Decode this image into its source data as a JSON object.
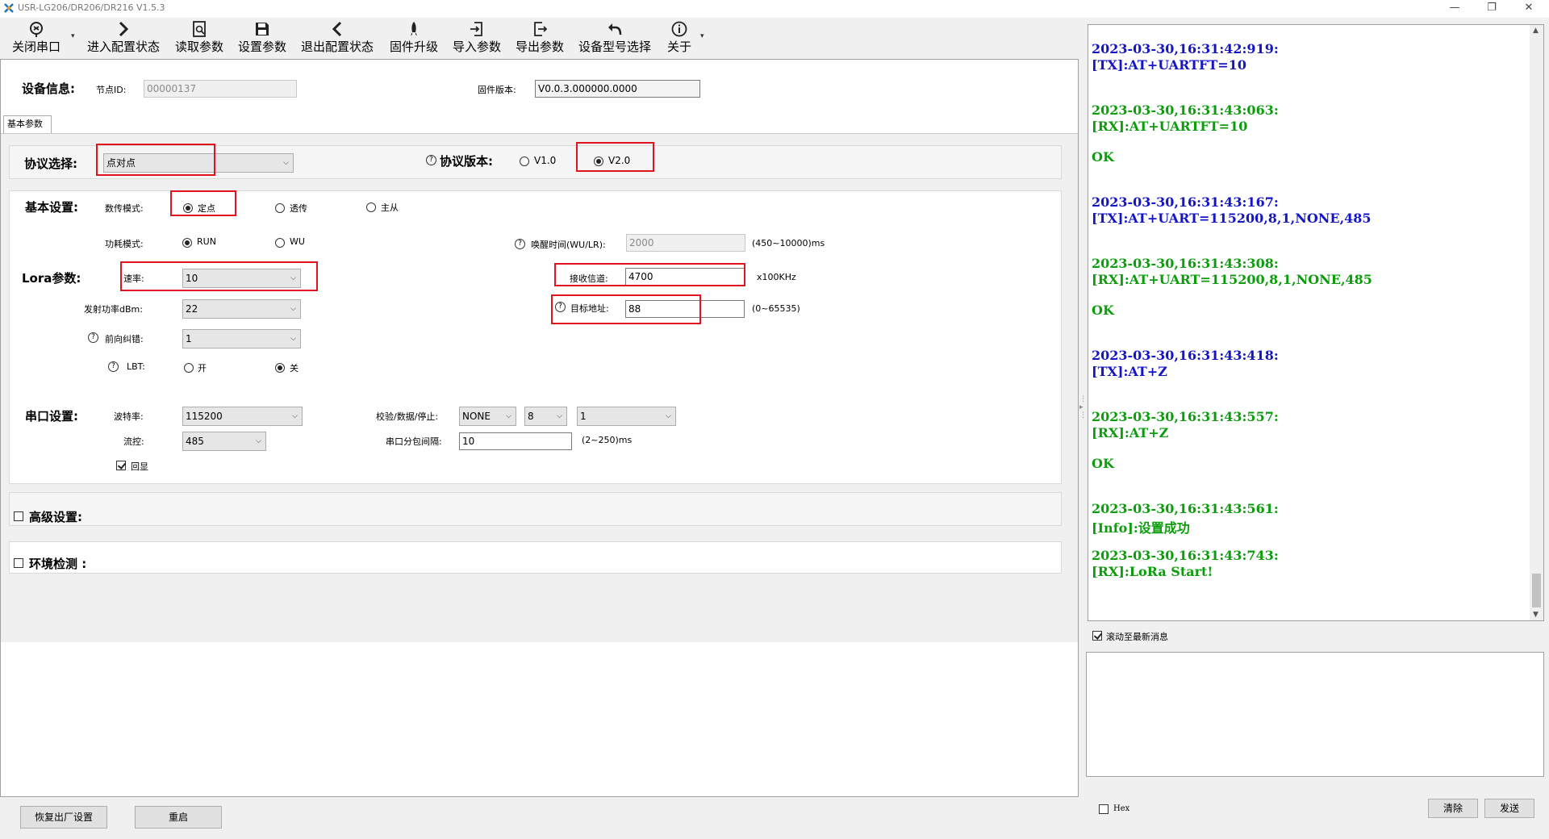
{
  "window": {
    "title": "USR-LG206/DR206/DR216 V1.5.3",
    "minimize": "—",
    "restore": "❐",
    "close": "✕"
  },
  "toolbar": {
    "close_port": "关闭串口",
    "enter_config": "进入配置状态",
    "read_params": "读取参数",
    "set_params": "设置参数",
    "exit_config": "退出配置状态",
    "firmware_upgrade": "固件升级",
    "import_params": "导入参数",
    "export_params": "导出参数",
    "device_model": "设备型号选择",
    "about": "关于"
  },
  "device_info": {
    "title": "设备信息:",
    "node_id_label": "节点ID:",
    "node_id_value": "00000137",
    "firmware_label": "固件版本:",
    "firmware_value": "V0.0.3.000000.0000"
  },
  "tab": {
    "label": "基本参数"
  },
  "protocol": {
    "title": "协议选择:",
    "selected": "点对点",
    "version_title": "协议版本:",
    "v1": "V1.0",
    "v2": "V2.0",
    "selected_version": "V2.0"
  },
  "basic": {
    "title": "基本设置:",
    "mode_label": "数传模式:",
    "mode_options": [
      "定点",
      "透传",
      "主从"
    ],
    "mode_selected": "定点",
    "power_label": "功耗模式:",
    "power_options": [
      "RUN",
      "WU"
    ],
    "power_selected": "RUN",
    "wake_label": "唤醒时间(WU/LR):",
    "wake_value": "2000",
    "wake_range": "(450~10000)ms"
  },
  "lora": {
    "title": "Lora参数:",
    "rate_label": "速率:",
    "rate_value": "10",
    "channel_label": "接收信道:",
    "channel_value": "4700",
    "channel_unit": "x100KHz",
    "tx_power_label": "发射功率dBm:",
    "tx_power_value": "22",
    "target_label": "目标地址:",
    "target_value": "88",
    "target_range": "(0~65535)",
    "fec_label": "前向纠错:",
    "fec_value": "1",
    "lbt_label": "LBT:",
    "lbt_on": "开",
    "lbt_off": "关",
    "lbt_selected": "关"
  },
  "serial": {
    "title": "串口设置:",
    "baud_label": "波特率:",
    "baud_value": "115200",
    "parity_label": "校验/数据/停止:",
    "parity_value": "NONE",
    "data_bits": "8",
    "stop_bits": "1",
    "flow_label": "流控:",
    "flow_value": "485",
    "interval_label": "串口分包间隔:",
    "interval_value": "10",
    "interval_range": "(2~250)ms",
    "echo_label": "回显",
    "echo_checked": true
  },
  "advanced": {
    "title": "高级设置:"
  },
  "env": {
    "title": "环境检测 :"
  },
  "bottom": {
    "factory_reset": "恢复出厂设置",
    "restart": "重启"
  },
  "log": {
    "lines": [
      {
        "text": "2023-03-30,16:31:42:919:",
        "color": "#1515c8"
      },
      {
        "text": "[TX]:AT+UARTFT=10",
        "color": "#1515c8"
      },
      {
        "text": "2023-03-30,16:31:43:063:",
        "color": "#0b9d0b"
      },
      {
        "text": "[RX]:AT+UARTFT=10",
        "color": "#0b9d0b"
      },
      {
        "text": "OK",
        "color": "#0b9d0b"
      },
      {
        "text": "2023-03-30,16:31:43:167:",
        "color": "#1515c8"
      },
      {
        "text": "[TX]:AT+UART=115200,8,1,NONE,485",
        "color": "#1515c8"
      },
      {
        "text": "2023-03-30,16:31:43:308:",
        "color": "#0b9d0b"
      },
      {
        "text": "[RX]:AT+UART=115200,8,1,NONE,485",
        "color": "#0b9d0b"
      },
      {
        "text": "OK",
        "color": "#0b9d0b"
      },
      {
        "text": "2023-03-30,16:31:43:418:",
        "color": "#1515c8"
      },
      {
        "text": "[TX]:AT+Z",
        "color": "#1515c8"
      },
      {
        "text": "2023-03-30,16:31:43:557:",
        "color": "#0b9d0b"
      },
      {
        "text": "[RX]:AT+Z",
        "color": "#0b9d0b"
      },
      {
        "text": "OK",
        "color": "#0b9d0b"
      },
      {
        "text": "2023-03-30,16:31:43:561:",
        "color": "#0b9d0b"
      },
      {
        "text": "[Info]:设置成功",
        "color": "#0b9d0b"
      },
      {
        "text": "2023-03-30,16:31:43:743:",
        "color": "#0b9d0b"
      },
      {
        "text": "[RX]:LoRa Start!",
        "color": "#0b9d0b"
      }
    ],
    "autoscroll_label": "滚动至最新消息",
    "autoscroll_checked": true,
    "hex_label": "Hex",
    "clear": "清除",
    "send": "发送"
  }
}
